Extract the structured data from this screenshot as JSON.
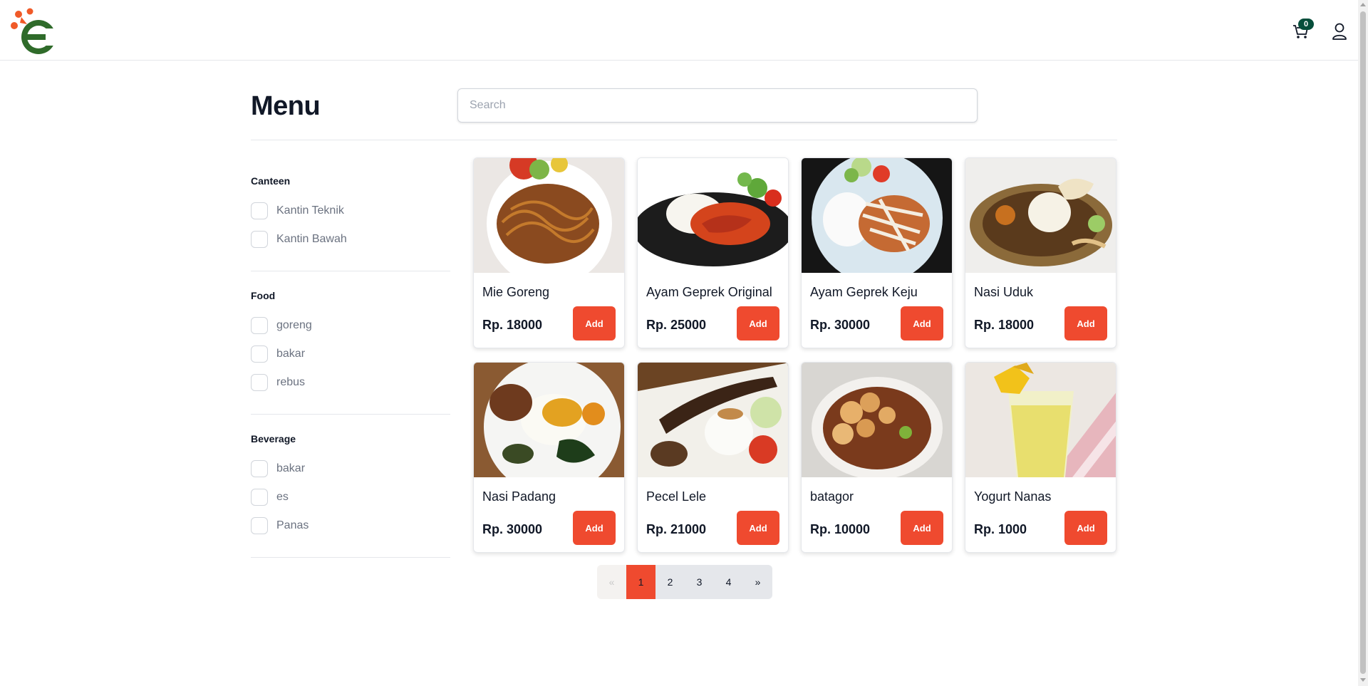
{
  "header": {
    "logo_alt": "E",
    "cart_count": "0"
  },
  "page": {
    "title": "Menu",
    "search_placeholder": "Search"
  },
  "filters": [
    {
      "title": "Canteen",
      "options": [
        "Kantin Teknik",
        "Kantin Bawah"
      ]
    },
    {
      "title": "Food",
      "options": [
        "goreng",
        "bakar",
        "rebus"
      ]
    },
    {
      "title": "Beverage",
      "options": [
        "bakar",
        "es",
        "Panas"
      ]
    }
  ],
  "products": [
    {
      "name": "Mie Goreng",
      "price": "Rp. 18000",
      "add_label": "Add",
      "image": "mie-goreng-photo"
    },
    {
      "name": "Ayam Geprek Original",
      "price": "Rp. 25000",
      "add_label": "Add",
      "image": "ayam-geprek-original-photo"
    },
    {
      "name": "Ayam Geprek Keju",
      "price": "Rp. 30000",
      "add_label": "Add",
      "image": "ayam-geprek-keju-photo"
    },
    {
      "name": "Nasi Uduk",
      "price": "Rp. 18000",
      "add_label": "Add",
      "image": "nasi-uduk-photo"
    },
    {
      "name": "Nasi Padang",
      "price": "Rp. 30000",
      "add_label": "Add",
      "image": "nasi-padang-photo"
    },
    {
      "name": "Pecel Lele",
      "price": "Rp. 21000",
      "add_label": "Add",
      "image": "pecel-lele-photo"
    },
    {
      "name": "batagor",
      "price": "Rp. 10000",
      "add_label": "Add",
      "image": "batagor-photo"
    },
    {
      "name": "Yogurt Nanas",
      "price": "Rp. 1000",
      "add_label": "Add",
      "image": "yogurt-nanas-photo"
    }
  ],
  "pagination": {
    "prev": "«",
    "pages": [
      "1",
      "2",
      "3",
      "4"
    ],
    "current": "1",
    "next": "»"
  },
  "colors": {
    "accent": "#ef4a2f",
    "badge": "#064e3b",
    "logo_orange": "#f05a28",
    "logo_green": "#2f6b2a"
  }
}
